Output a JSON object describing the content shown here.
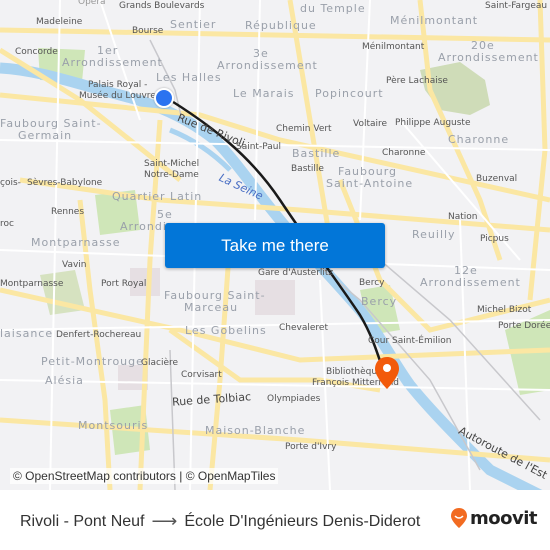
{
  "map": {
    "labels": {
      "opera": "Opéra",
      "grands_boulevards": "Grands Boulevards",
      "sentier": "Sentier",
      "republique": "République",
      "faubourg_du_temple": "du Temple",
      "menilmontant_district": "Ménilmontant",
      "saint_fargeau": "Saint-Fargeau",
      "madeleine": "Madeleine",
      "bourse": "Bourse",
      "concorde": "Concorde",
      "arr1_a": "1er",
      "arr1_b": "Arrondissement",
      "arr3_a": "3e",
      "arr3_b": "Arrondissement",
      "menilmontant_station": "Ménilmontant",
      "arr20_a": "20e",
      "arr20_b": "Arrondissement",
      "les_halles": "Les Halles",
      "palais_royal_a": "Palais Royal -",
      "palais_royal_b": "Musée du Louvre",
      "le_marais": "Le Marais",
      "popincourt": "Popincourt",
      "pere_lachaise": "Père Lachaise",
      "faubourg_saint_germain_a": "Faubourg Saint-",
      "faubourg_saint_germain_b": "Germain",
      "rue_de_rivoli": "Rue de Rivoli",
      "chemin_vert": "Chemin Vert",
      "voltaire": "Voltaire",
      "philippe_auguste": "Philippe Auguste",
      "charonne_district": "Charonne",
      "saint_paul": "Saint-Paul",
      "bastille_district": "Bastille",
      "charonne_station": "Charonne",
      "saint_michel_a": "Saint-Michel",
      "saint_michel_b": "Notre-Dame",
      "bastille_station": "Bastille",
      "faubourg_saint_antoine_a": "Faubourg",
      "faubourg_saint_antoine_b": "Saint-Antoine",
      "buzenval": "Buzenval",
      "francois": "çois-",
      "sevres_babylone": "Sèvres-Babylone",
      "la_seine": "La Seine",
      "quartier_latin": "Quartier Latin",
      "rennes": "Rennes",
      "arr5_a": "5e",
      "arr5_b": "Arrondis",
      "nation": "Nation",
      "roc": "roc",
      "montparnasse_district": "Montparnasse",
      "reuilly": "Reuilly",
      "picpus": "Picpus",
      "vavin": "Vavin",
      "gare_austerlitz": "Gare d'Austerlitz",
      "arr12_a": "12e",
      "arr12_b": "Arrondissement",
      "montparnasse_station": "Montparnasse",
      "port_royal": "Port Royal",
      "bercy_station": "Bercy",
      "faubourg_saint_marceau_a": "Faubourg Saint-",
      "faubourg_saint_marceau_b": "Marceau",
      "bercy_district": "Bercy",
      "michel_bizot": "Michel Bizot",
      "plaisance": "laisance",
      "denfert": "Denfert-Rochereau",
      "les_gobelins": "Les Gobelins",
      "chevaleret": "Chevaleret",
      "porte_doree": "Porte Dorée",
      "cour_saint_emilion": "Cour Saint-Émilion",
      "petit_montrouge": "Petit-Montrouge",
      "glaciere": "Glacière",
      "bibliotheque_a": "Bibliothèque",
      "bibliotheque_b": "François Mitterrand",
      "corvisart": "Corvisart",
      "alesia": "Alésia",
      "rue_de_tolbiac": "Rue de Tolbiac",
      "olympiades": "Olympiades",
      "montsouris": "Montsouris",
      "maison_blanche": "Maison-Blanche",
      "porte_ivry": "Porte d'Ivry",
      "autoroute_est": "Autoroute de l'Est"
    },
    "origin_marker_color": "#2b73f0",
    "destination_marker_color": "#f25a0b",
    "route_line_color": "#1a1a1a"
  },
  "cta": {
    "label": "Take me there",
    "color": "#0276d8"
  },
  "attribution": "© OpenStreetMap contributors | © OpenMapTiles",
  "footer": {
    "origin": "Rivoli - Pont Neuf",
    "arrow": "⟶",
    "destination": "École D'Ingénieurs Denis-Diderot",
    "brand": "moovit",
    "brand_color": "#f26b21"
  }
}
